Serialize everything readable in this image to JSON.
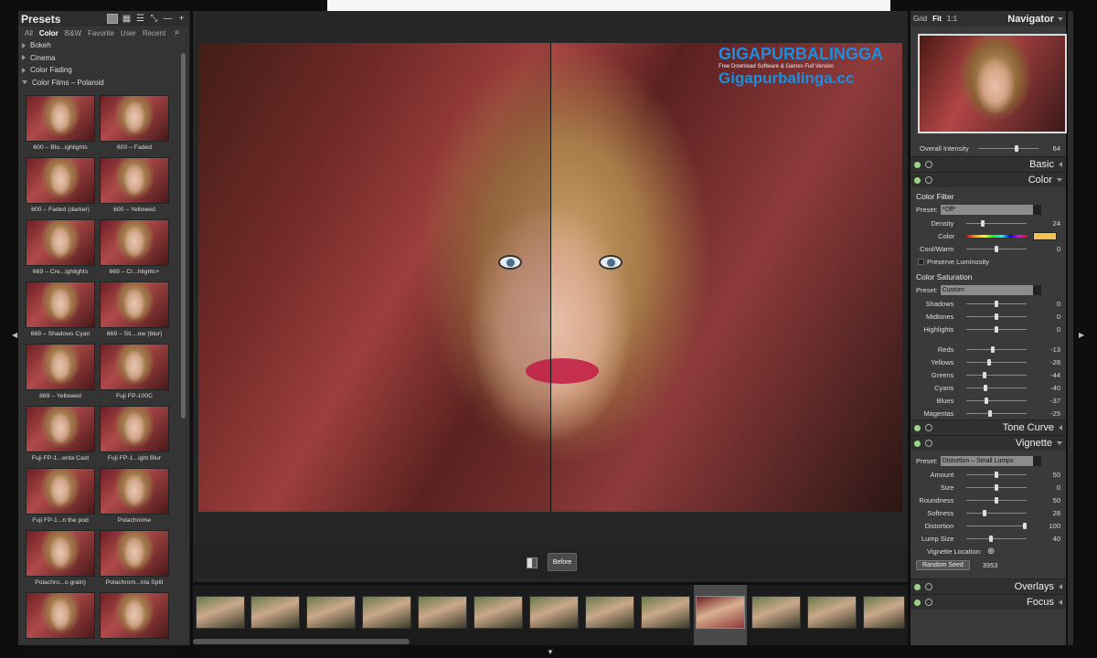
{
  "presets": {
    "title": "Presets",
    "tabs": [
      "All",
      "Color",
      "B&W",
      "Favorite",
      "User",
      "Recent"
    ],
    "categories": [
      "Bokeh",
      "Cinema",
      "Color Fading",
      "Color Films – Polaroid"
    ],
    "thumbs": [
      "600 – Blo...ighlights",
      "600 – Faded",
      "600 – Faded (darker)",
      "600 – Yellowed",
      "669 – Cre...ighlights",
      "669 – Cr...hlights+",
      "669 – Shadows Cyan",
      "669 – Sli....ow (blur)",
      "669 – Yellowed",
      "Fuji FP-100C",
      "Fuji FP-1...enta Cast",
      "Fuji FP-1...ight Blur",
      "Fuji FP-1...n the pod",
      "Polachrome",
      "Polachro...o grain)",
      "Polachrom...nta Split",
      "",
      ""
    ]
  },
  "main": {
    "before_label": "Before"
  },
  "watermark": {
    "line1": "GIGAPURBALINGGA",
    "line2": "Free Download Software & Games Full Version",
    "line3": "Gigapurbalinga.cc"
  },
  "navigator": {
    "grid": "Grid",
    "fit": "Fit",
    "one_to_one": "1:1",
    "title": "Navigator",
    "overall_label": "Overall Intensity",
    "overall_value": "64",
    "overall_fraction": 0.64
  },
  "sections": {
    "basic": "Basic",
    "color": "Color",
    "tone_curve": "Tone Curve",
    "vignette": "Vignette",
    "overlays": "Overlays",
    "focus": "Focus"
  },
  "color_filter": {
    "title": "Color Filter",
    "preset_label": "Preset:",
    "preset_value": "*Off*",
    "density_label": "Density",
    "density": "24",
    "color_label": "Color",
    "coolwarm_label": "Cool/Warm",
    "coolwarm": "0",
    "preserve": "Preserve Luminosity"
  },
  "saturation": {
    "title": "Color Saturation",
    "preset_label": "Preset:",
    "preset_value": "Custom",
    "rows": [
      {
        "l": "Shadows",
        "v": "0"
      },
      {
        "l": "Midtones",
        "v": "0"
      },
      {
        "l": "Highlights",
        "v": "0"
      },
      {
        "l": "Reds",
        "v": "-13"
      },
      {
        "l": "Yellows",
        "v": "-28"
      },
      {
        "l": "Greens",
        "v": "-44"
      },
      {
        "l": "Cyans",
        "v": "-40"
      },
      {
        "l": "Blues",
        "v": "-37"
      },
      {
        "l": "Magentas",
        "v": "-25"
      }
    ]
  },
  "vignette": {
    "preset_label": "Preset:",
    "preset_value": "Distortion – Small Lumps",
    "rows": [
      {
        "l": "Amount",
        "v": "50"
      },
      {
        "l": "Size",
        "v": "0"
      },
      {
        "l": "Roundness",
        "v": "50"
      },
      {
        "l": "Softness",
        "v": "28"
      },
      {
        "l": "Distortion",
        "v": "100"
      },
      {
        "l": "Lump Size",
        "v": "40"
      }
    ],
    "location_label": "Vignette Location:",
    "seed_label": "Random Seed",
    "seed_value": "3953"
  }
}
